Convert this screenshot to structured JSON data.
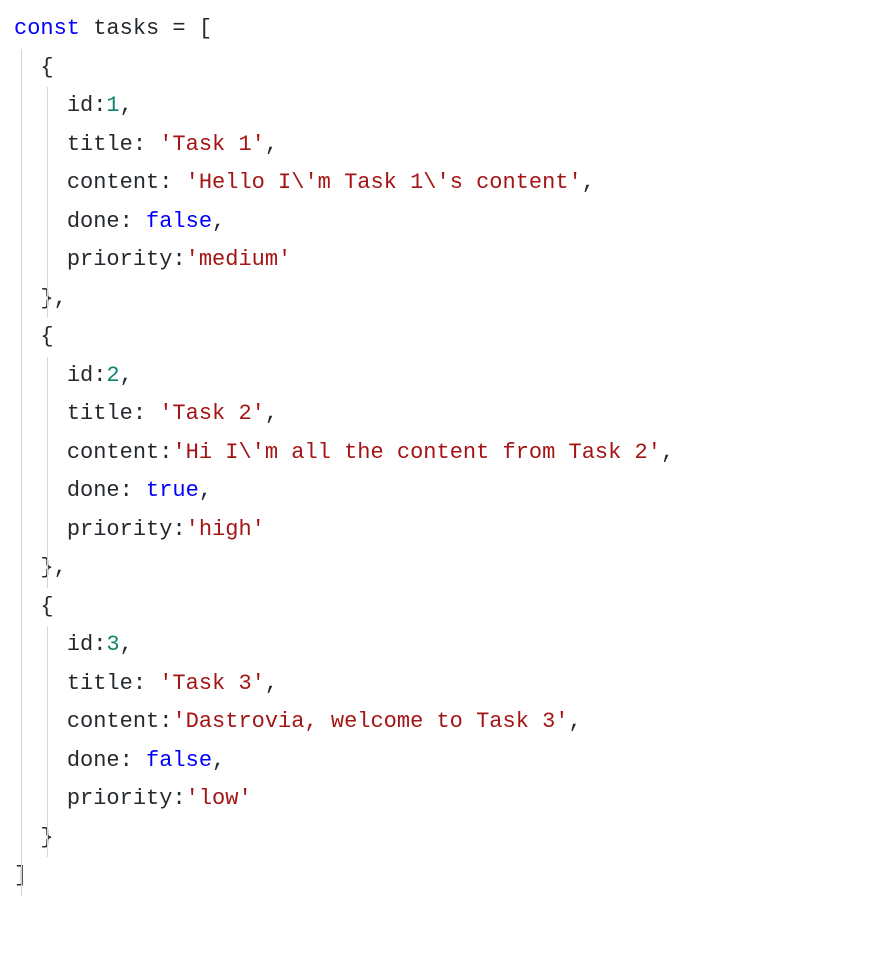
{
  "code": {
    "keyword_const": "const",
    "var_name": "tasks",
    "eq": " = ",
    "open_bracket": "[",
    "close_bracket": "]",
    "open_brace": "{",
    "close_brace": "}",
    "comma": ",",
    "colon": ":",
    "colon_sp": ": ",
    "items": [
      {
        "id_key": "id",
        "id_val": "1",
        "title_key": "title",
        "title_val": "'Task 1'",
        "content_key": "content",
        "content_open": "'Hello I",
        "content_esc1": "\\'",
        "content_mid": "m Task 1",
        "content_esc2": "\\'",
        "content_end": "s content'",
        "done_key": "done",
        "done_val": "false",
        "priority_key": "priority",
        "priority_val": "'medium'"
      },
      {
        "id_key": "id",
        "id_val": "2",
        "title_key": "title",
        "title_val": "'Task 2'",
        "content_key": "content",
        "content_open": "'Hi I",
        "content_esc1": "\\'",
        "content_mid": "m all the content from Task 2'",
        "content_esc2": "",
        "content_end": "",
        "done_key": "done",
        "done_val": "true",
        "priority_key": "priority",
        "priority_val": "'high'"
      },
      {
        "id_key": "id",
        "id_val": "3",
        "title_key": "title",
        "title_val": "'Task 3'",
        "content_key": "content",
        "content_open": "'Dastrovia, welcome to Task 3'",
        "content_esc1": "",
        "content_mid": "",
        "content_esc2": "",
        "content_end": "",
        "done_key": "done",
        "done_val": "false",
        "priority_key": "priority",
        "priority_val": "'low'"
      }
    ]
  }
}
